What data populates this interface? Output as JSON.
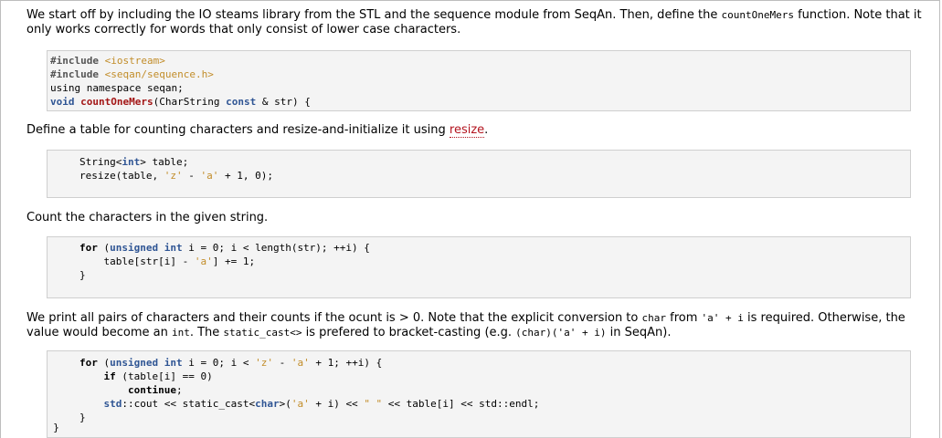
{
  "paragraphs": {
    "p1_text1": "We start off by including the IO steams library from the STL and the sequence module from SeqAn. Then, define the ",
    "p1_code": "countOneMers",
    "p1_text2": " function. Note that it only works correctly for words that only consist of lower case characters.",
    "p2_text1": "Define a table for counting characters and resize-and-initialize it using ",
    "p2_link": "resize",
    "p2_text2": ".",
    "p3_text": "Count the characters in the given string.",
    "p4_text1": "We print all pairs of characters and their counts if the ocunt is > 0. Note that the explicit conversion to ",
    "p4_code1": "char",
    "p4_text2": " from ",
    "p4_code2": "'a' + i",
    "p4_text3": " is required. Otherwise, the value would become an ",
    "p4_code3": "int",
    "p4_text4": ". The ",
    "p4_code4": "static_cast<>",
    "p4_text5": " is prefered to bracket-casting (e.g. ",
    "p4_code5": "(char)('a' + i)",
    "p4_text6": " in SeqAn)."
  },
  "code1": {
    "l1_pp": "#include",
    "l1_str": "<iostream>",
    "l2_pp": "#include",
    "l2_str": "<seqan/sequence.h>",
    "l3": "using namespace seqan;",
    "l4_kw": "void",
    "l4_fn": "countOneMers",
    "l4_a": "(CharString ",
    "l4_kw2": "const",
    "l4_b": " & str) {"
  },
  "code2": {
    "l1_a": "String<",
    "l1_kw": "int",
    "l1_b": "> table;",
    "l2_a": "resize(table, ",
    "l2_s1": "'z'",
    "l2_b": " - ",
    "l2_s2": "'a'",
    "l2_c": " + 1, 0);"
  },
  "code3": {
    "l1_bk": "for",
    "l1_a": " (",
    "l1_kw1": "unsigned",
    "l1_sp": " ",
    "l1_kw2": "int",
    "l1_b": " i = 0; i < length(str); ++i) {",
    "l2_a": "    table[str[i] - ",
    "l2_s": "'a'",
    "l2_b": "] += 1;",
    "l3": "}"
  },
  "code4": {
    "l1_bk": "for",
    "l1_a": " (",
    "l1_kw1": "unsigned",
    "l1_sp": " ",
    "l1_kw2": "int",
    "l1_b": " i = 0; i < ",
    "l1_s1": "'z'",
    "l1_c": " - ",
    "l1_s2": "'a'",
    "l1_d": " + 1; ++i) {",
    "l2_ind": "    ",
    "l2_bk": "if",
    "l2_a": " (table[i] == 0)",
    "l3_ind": "        ",
    "l3_bk": "continue",
    "l3_a": ";",
    "l4_ind": "    ",
    "l4_kw": "std",
    "l4_a": "::cout << static_cast<",
    "l4_kw2": "char",
    "l4_b": ">(",
    "l4_s1": "'a'",
    "l4_c": " + i) << ",
    "l4_s2": "\" \"",
    "l4_d": " << table[i] << std::endl;",
    "l5": "}",
    "tail": "}"
  }
}
